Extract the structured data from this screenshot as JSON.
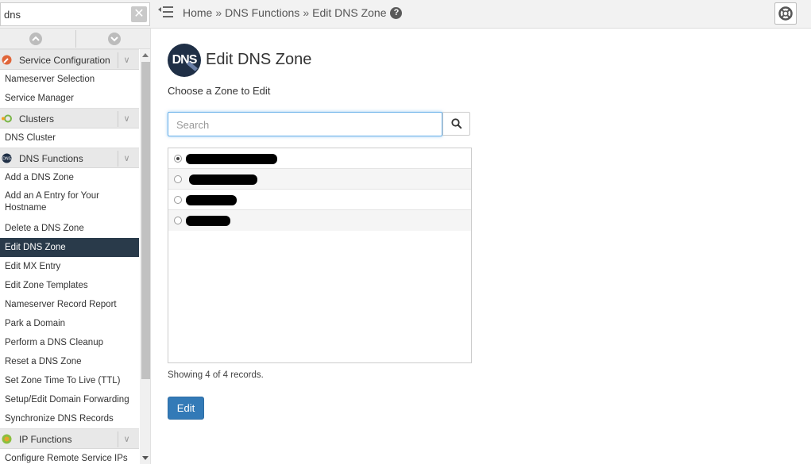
{
  "search": {
    "value": "dns",
    "clear_icon": "x-icon"
  },
  "breadcrumb": {
    "home": "Home",
    "sep1": "»",
    "section": "DNS Functions",
    "sep2": "»",
    "current": "Edit DNS Zone",
    "help": "?"
  },
  "sidebar": {
    "categories": [
      {
        "label": "Service Configuration",
        "icon": "wrench-icon"
      },
      {
        "label": "Clusters",
        "icon": "cluster-icon"
      },
      {
        "label": "DNS Functions",
        "icon": "dns-icon"
      },
      {
        "label": "IP Functions",
        "icon": "ip-icon"
      }
    ],
    "chevron": "∨",
    "items_service": [
      "Nameserver Selection",
      "Service Manager"
    ],
    "items_clusters": [
      "DNS Cluster"
    ],
    "items_dns": [
      "Add a DNS Zone",
      "Add an A Entry for Your Hostname",
      "Delete a DNS Zone",
      "Edit DNS Zone",
      "Edit MX Entry",
      "Edit Zone Templates",
      "Nameserver Record Report",
      "Park a Domain",
      "Perform a DNS Cleanup",
      "Reset a DNS Zone",
      "Set Zone Time To Live (TTL)",
      "Setup/Edit Domain Forwarding",
      "Synchronize DNS Records"
    ],
    "items_ip": [
      "Configure Remote Service IPs"
    ],
    "active_item": "Edit DNS Zone"
  },
  "main": {
    "logo_text": "DNS",
    "title": "Edit DNS Zone",
    "subtitle": "Choose a Zone to Edit",
    "search_placeholder": "Search",
    "zones": [
      {
        "selected": true,
        "redacted": true
      },
      {
        "selected": false,
        "redacted": true
      },
      {
        "selected": false,
        "redacted": true
      },
      {
        "selected": false,
        "redacted": true
      }
    ],
    "showing": "Showing 4 of 4 records.",
    "edit_label": "Edit"
  },
  "colors": {
    "active_bg": "#293a4a",
    "primary": "#337ab7",
    "focus": "#66afe9"
  }
}
